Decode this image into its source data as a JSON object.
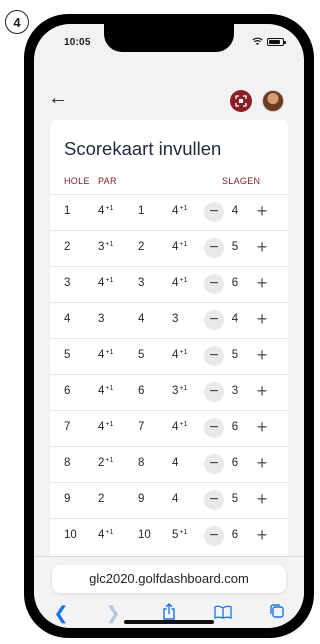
{
  "step_number": "4",
  "status": {
    "time": "10:05"
  },
  "page": {
    "title": "Scorekaart invullen",
    "columns": {
      "hole": "HOLE",
      "par": "PAR",
      "strokes": "SLAGEN"
    }
  },
  "holes": [
    {
      "hole": "1",
      "par": "4",
      "par_extra": "+1",
      "hcp_hole": "1",
      "hcp_par": "4",
      "hcp_extra": "+1",
      "score": "4"
    },
    {
      "hole": "2",
      "par": "3",
      "par_extra": "+1",
      "hcp_hole": "2",
      "hcp_par": "4",
      "hcp_extra": "+1",
      "score": "5"
    },
    {
      "hole": "3",
      "par": "4",
      "par_extra": "+1",
      "hcp_hole": "3",
      "hcp_par": "4",
      "hcp_extra": "+1",
      "score": "6"
    },
    {
      "hole": "4",
      "par": "3",
      "par_extra": "",
      "hcp_hole": "4",
      "hcp_par": "3",
      "hcp_extra": "",
      "score": "4"
    },
    {
      "hole": "5",
      "par": "4",
      "par_extra": "+1",
      "hcp_hole": "5",
      "hcp_par": "4",
      "hcp_extra": "+1",
      "score": "5"
    },
    {
      "hole": "6",
      "par": "4",
      "par_extra": "+1",
      "hcp_hole": "6",
      "hcp_par": "3",
      "hcp_extra": "+1",
      "score": "3"
    },
    {
      "hole": "7",
      "par": "4",
      "par_extra": "+1",
      "hcp_hole": "7",
      "hcp_par": "4",
      "hcp_extra": "+1",
      "score": "6"
    },
    {
      "hole": "8",
      "par": "2",
      "par_extra": "+1",
      "hcp_hole": "8",
      "hcp_par": "4",
      "hcp_extra": "",
      "score": "6"
    },
    {
      "hole": "9",
      "par": "2",
      "par_extra": "",
      "hcp_hole": "9",
      "hcp_par": "4",
      "hcp_extra": "",
      "score": "5"
    },
    {
      "hole": "10",
      "par": "4",
      "par_extra": "+1",
      "hcp_hole": "10",
      "hcp_par": "5",
      "hcp_extra": "+1",
      "score": "6"
    }
  ],
  "controls": {
    "minus": "−",
    "plus": "+"
  },
  "browser": {
    "url": "glc2020.golfdashboard.com"
  },
  "colors": {
    "accent": "#7d1c22",
    "link": "#1a73e8"
  }
}
